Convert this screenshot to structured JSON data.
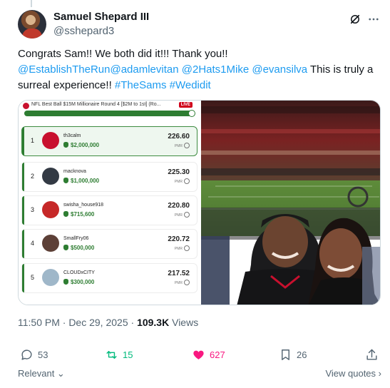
{
  "author": {
    "name": "Samuel Shepard III",
    "handle": "@sshepard3"
  },
  "tweet": {
    "text_parts": [
      {
        "text": "Congrats Sam!! We both did it!!! Thank you!! ",
        "link": false
      },
      {
        "text": "@EstablishTheRun",
        "link": true
      },
      {
        "text": "@adamlevitan",
        "link": true
      },
      {
        "text": " ",
        "link": false
      },
      {
        "text": "@2Hats1Mike",
        "link": true
      },
      {
        "text": " ",
        "link": false
      },
      {
        "text": "@evansilva",
        "link": true
      },
      {
        "text": " This is truly a surreal experience!! ",
        "link": false
      },
      {
        "text": "#TheSams",
        "link": true
      },
      {
        "text": " ",
        "link": false
      },
      {
        "text": "#Wedidit",
        "link": true
      }
    ]
  },
  "leaderboard": {
    "title": "NFL Best Ball $15M Millionaire Round 4 [$2M to 1st] (Ro...",
    "live_label": "LIVE",
    "progress": 1.0,
    "rows": [
      {
        "rank": "1",
        "user": "th3calm",
        "prize": "$2,000,000",
        "score": "226.60",
        "pmr": "PMR",
        "avatar_color": "#c8102e"
      },
      {
        "rank": "2",
        "user": "macknova",
        "prize": "$1,000,000",
        "score": "225.30",
        "pmr": "PMR",
        "avatar_color": "#333a44"
      },
      {
        "rank": "3",
        "user": "swisha_house918",
        "prize": "$715,600",
        "score": "220.80",
        "pmr": "PMR",
        "avatar_color": "#c62828"
      },
      {
        "rank": "4",
        "user": "SmallFry06",
        "prize": "$500,000",
        "score": "220.72",
        "pmr": "PMR",
        "avatar_color": "#5d4037"
      },
      {
        "rank": "5",
        "user": "CLOUDxCITY",
        "prize": "$300,000",
        "score": "217.52",
        "pmr": "PMR",
        "avatar_color": "#9fb7c9"
      }
    ]
  },
  "meta": {
    "time": "11:50 PM · Dec 29, 2025 · ",
    "views_count": "109.3K",
    "views_label": " Views"
  },
  "actions": {
    "replies": "53",
    "reposts": "15",
    "likes": "627",
    "bookmarks": "26"
  },
  "footer": {
    "relevant": "Relevant",
    "view_quotes": "View quotes"
  },
  "colors": {
    "link": "#1d9bf0",
    "repost": "#00ba7c",
    "like": "#f91880",
    "leaderboard_green": "#2e7d32"
  },
  "icons": [
    "grok-icon",
    "more-icon",
    "reply-icon",
    "repost-icon",
    "like-icon",
    "bookmark-icon",
    "share-icon",
    "chevron-down-icon",
    "chevron-right-icon"
  ]
}
